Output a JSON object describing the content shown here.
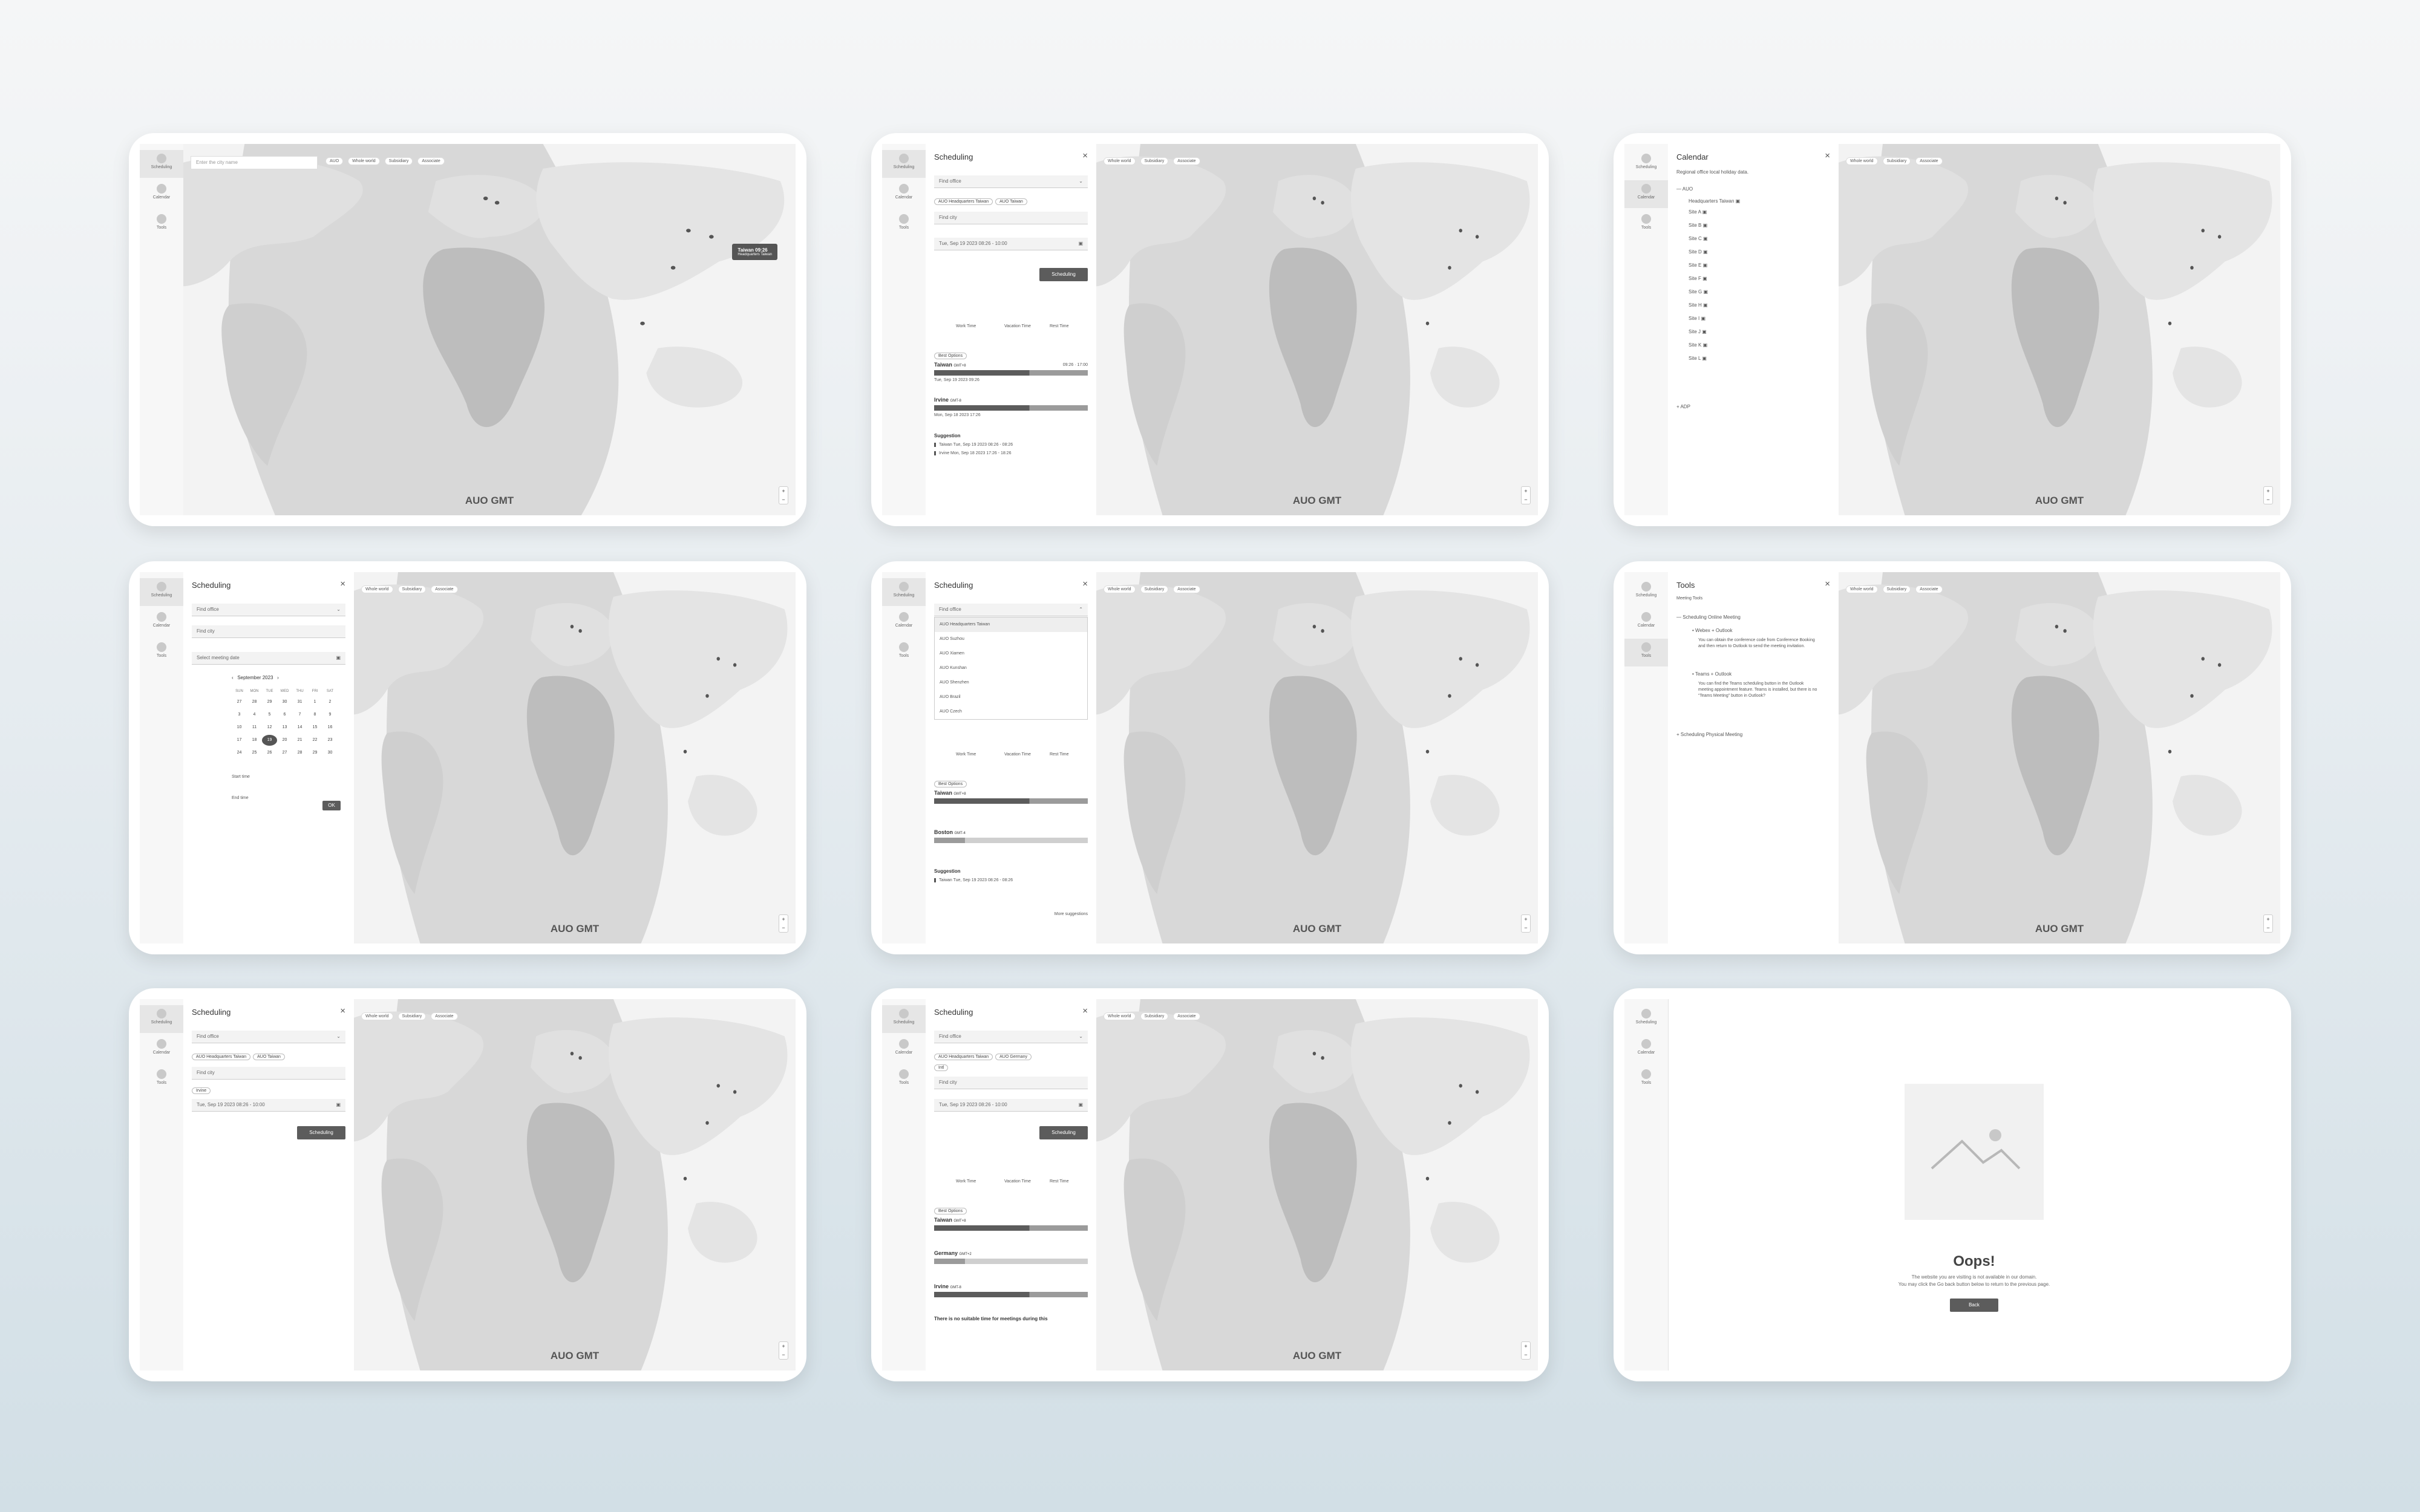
{
  "nav": {
    "scheduling": "Scheduling",
    "calendar": "Calendar",
    "tools": "Tools"
  },
  "map": {
    "label": "AUO GMT",
    "zoom_in": "+",
    "zoom_out": "−",
    "chips": [
      "Whole world",
      "Subsidiary",
      "Associate"
    ]
  },
  "search": {
    "placeholder": "Enter the city name",
    "filter": "AUO"
  },
  "tooltip": {
    "title": "Taiwan 09:26",
    "subtitle": "Headquarters Taiwan"
  },
  "scheduling": {
    "title": "Scheduling",
    "close": "×",
    "site_placeholder": "Find office",
    "tag_hq": "AUO Headquarters Taiwan",
    "tag_taiwan": "AUO Taiwan",
    "tag_germany": "AUO Germany",
    "tag_irvine": "Irvine",
    "tag_intl": "Intl",
    "find_city": "Find city",
    "datetime": "Tue, Sep 19 2023 08:26 - 10:00",
    "select_date": "Select meeting date",
    "button": "Scheduling",
    "legend": [
      "Work Time",
      "Vacation Time",
      "Rest Time"
    ],
    "badge": "Best Options",
    "city1": "Taiwan",
    "city1_tz": "GMT+8",
    "city1_status": "09:26 · 17:00",
    "city1_date": "Tue, Sep 19 2023 09:26",
    "city2": "Irvine",
    "city2_tz": "GMT-8",
    "city2_date": "Mon, Sep 18 2023 17:26",
    "city_boston": "Boston",
    "city_boston_tz": "GMT-4",
    "city_germany": "Germany",
    "city_germany_tz": "GMT+2",
    "suggestion": "Suggestion",
    "sug1": "Taiwan Tue, Sep 19 2023 08:26 - 08:26",
    "sug2": "Irvine Mon, Sep 18 2023 17:26 - 18:26",
    "more": "More suggestions",
    "no_time": "There is no suitable time for meetings during this"
  },
  "picker": {
    "month": "September 2023",
    "weekdays": [
      "SUN",
      "MON",
      "TUE",
      "WED",
      "THU",
      "FRI",
      "SAT"
    ],
    "days": [
      "27",
      "28",
      "29",
      "30",
      "31",
      "1",
      "2",
      "3",
      "4",
      "5",
      "6",
      "7",
      "8",
      "9",
      "10",
      "11",
      "12",
      "13",
      "14",
      "15",
      "16",
      "17",
      "18",
      "19",
      "20",
      "21",
      "22",
      "23",
      "24",
      "25",
      "26",
      "27",
      "28",
      "29",
      "30"
    ],
    "start_label": "Start time",
    "end_label": "End time",
    "ok": "OK"
  },
  "dropdown": {
    "items": [
      "AUO Headquarters Taiwan",
      "AUO Suzhou",
      "AUO Xiamen",
      "AUO Kunshan",
      "AUO Shenzhen",
      "AUO Brazil",
      "AUO Czech"
    ]
  },
  "calendar": {
    "title": "Calendar",
    "note": "Regional office local holiday data.",
    "group": "AUO",
    "hq": "Headquarters Taiwan",
    "sites": [
      "Site A",
      "Site B",
      "Site C",
      "Site D",
      "Site E",
      "Site F",
      "Site G",
      "Site H",
      "Site I",
      "Site J",
      "Site K",
      "Site L"
    ],
    "group2": "ADP"
  },
  "tools": {
    "title": "Tools",
    "sub": "Meeting Tools",
    "sec1": "Scheduling Online Meeting",
    "item1": "Webex + Outlook",
    "text1": "You can obtain the conference code from Conference Booking and then return to Outlook to send the meeting invitation.",
    "item2": "Teams + Outlook",
    "text2": "You can find the Teams scheduling button in the Outlook meeting appointment feature. Teams is installed, but there is no “Teams Meeting” button in Outlook?",
    "sec2": "Scheduling Physical Meeting"
  },
  "error": {
    "title": "Oops!",
    "line1": "The website you are visiting is not available in our domain.",
    "line2": "You may click the Go back button below to return to the previous page.",
    "button": "Back"
  }
}
